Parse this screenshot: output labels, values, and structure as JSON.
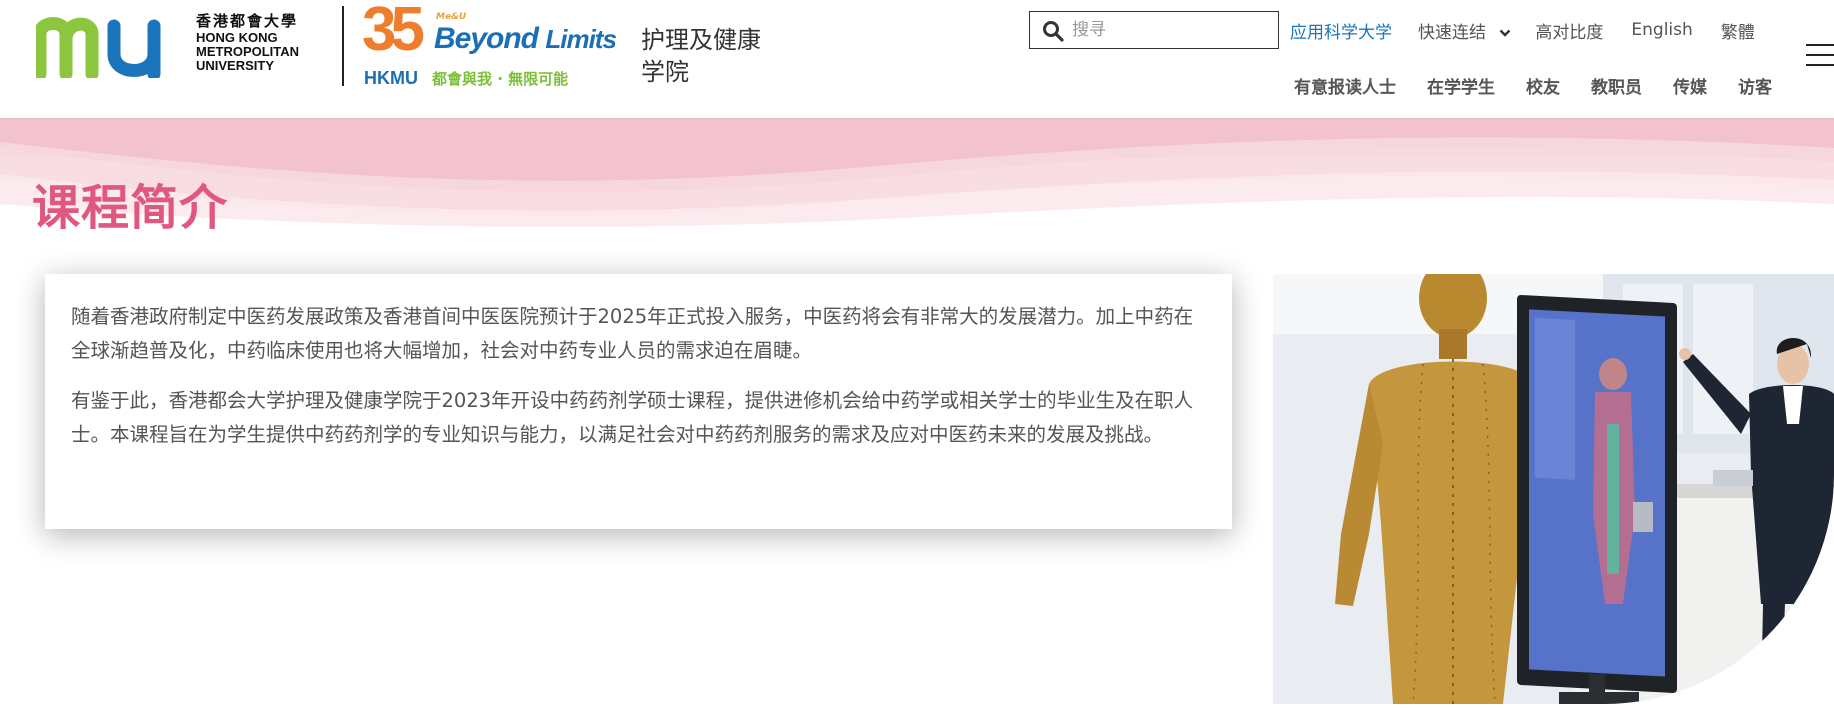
{
  "header": {
    "logo": {
      "name_zh": "香港都會大學",
      "name_en_lines": [
        "HONG KONG",
        "METROPOLITAN",
        "UNIVERSITY"
      ]
    },
    "anniversary": {
      "number": "35",
      "tag": "Me&U",
      "beyond": "Beyond",
      "limits": "Limits",
      "hkmu": "HKMU",
      "slogan": "都會與我 · 無限可能"
    },
    "school_name": "护理及健康学院",
    "search": {
      "placeholder": "搜寻",
      "value": ""
    },
    "top_links": {
      "university": "应用科学大学",
      "quick_links": "快速连结",
      "contrast": "高对比度",
      "english": "English",
      "traditional": "繁體"
    },
    "main_nav": [
      "有意报读人士",
      "在学学生",
      "校友",
      "教职员",
      "传媒",
      "访客"
    ]
  },
  "page": {
    "title": "课程简介",
    "paragraphs": [
      "随着香港政府制定中医药发展政策及香港首间中医医院预计于2025年正式投入服务，中医药将会有非常大的发展潜力。加上中药在全球渐趋普及化，中药临床使用也将大幅增加，社会对中药专业人员的需求迫在眉睫。",
      "有鉴于此，香港都会大学护理及健康学院于2023年开设中药药剂学硕士课程，提供进修机会给中药学或相关学士的毕业生及在职人士。本课程旨在为学生提供中药药剂学的专业知识与能力，以满足社会对中药药剂服务的需求及应对中医药未来的发展及挑战。"
    ]
  },
  "colors": {
    "title_pink": "#e0577f",
    "link_blue": "#1b75bc",
    "logo_green": "#8cc63f",
    "logo_blue": "#1b75bc",
    "wave_pink": "#f3c9d3"
  }
}
